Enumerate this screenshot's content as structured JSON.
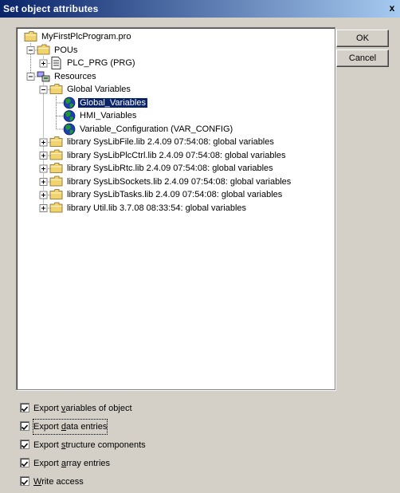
{
  "window": {
    "title": "Set object attributes",
    "close_glyph": "x"
  },
  "buttons": {
    "ok": "OK",
    "cancel": "Cancel"
  },
  "tree": {
    "selected_index": 5,
    "items": [
      {
        "label": "MyFirstPlcProgram.pro",
        "icon": "folder-icon"
      },
      {
        "label": "POUs",
        "icon": "folder-icon",
        "expander": "minus"
      },
      {
        "label": "PLC_PRG (PRG)",
        "icon": "document-icon",
        "expander": "plus"
      },
      {
        "label": "Resources",
        "icon": "resources-icon",
        "expander": "minus"
      },
      {
        "label": "Global Variables",
        "icon": "folder-icon",
        "expander": "minus"
      },
      {
        "label": "Global_Variables",
        "icon": "globe-icon"
      },
      {
        "label": "HMI_Variables",
        "icon": "globe-icon"
      },
      {
        "label": "Variable_Configuration (VAR_CONFIG)",
        "icon": "globe-icon"
      },
      {
        "label": "library SysLibFile.lib 2.4.09 07:54:08: global variables",
        "icon": "folder-icon",
        "expander": "plus"
      },
      {
        "label": "library SysLibPlcCtrl.lib 2.4.09 07:54:08: global variables",
        "icon": "folder-icon",
        "expander": "plus"
      },
      {
        "label": "library SysLibRtc.lib 2.4.09 07:54:08: global variables",
        "icon": "folder-icon",
        "expander": "plus"
      },
      {
        "label": "library SysLibSockets.lib 2.4.09 07:54:08: global variables",
        "icon": "folder-icon",
        "expander": "plus"
      },
      {
        "label": "library SysLibTasks.lib 2.4.09 07:54:08: global variables",
        "icon": "folder-icon",
        "expander": "plus"
      },
      {
        "label": "library Util.lib 3.7.08 08:33:54: global variables",
        "icon": "folder-icon",
        "expander": "plus"
      }
    ]
  },
  "options": [
    {
      "pre": "Export ",
      "mnemonic": "v",
      "post": "ariables of object",
      "checked": true
    },
    {
      "pre": "Export ",
      "mnemonic": "d",
      "post": "ata entries",
      "checked": true
    },
    {
      "pre": "Export ",
      "mnemonic": "s",
      "post": "tructure components",
      "checked": true
    },
    {
      "pre": "Export ",
      "mnemonic": "a",
      "post": "rray entries",
      "checked": true
    },
    {
      "pre": "",
      "mnemonic": "W",
      "post": "rite access",
      "checked": true
    }
  ],
  "colors": {
    "selection": "#0a246a",
    "folder": "#f2d46f",
    "globe_green": "#1f9a2a",
    "globe_blue": "#1b3fb0"
  }
}
